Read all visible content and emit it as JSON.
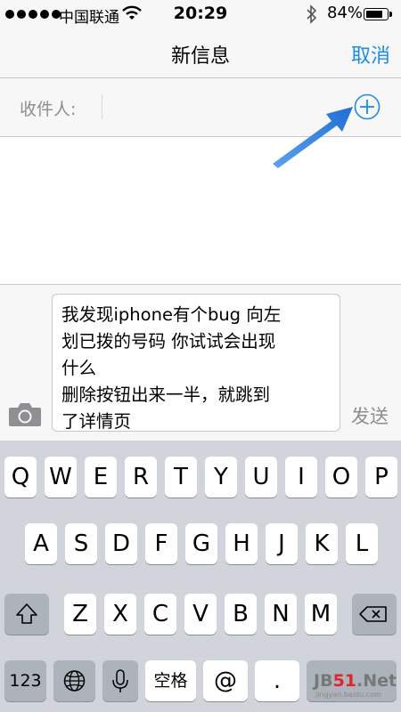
{
  "status_bar": {
    "carrier": "中国联通",
    "time": "20:29",
    "battery": "84%",
    "battery_level": 0.84
  },
  "nav": {
    "title": "新信息",
    "cancel": "取消"
  },
  "recipient": {
    "label": "收件人:"
  },
  "compose": {
    "lines": [
      "我发现iphone有个bug 向左",
      "划已拨的号码 你试试会出现",
      "什么",
      "删除按钮出来一半，就跳到",
      "了详情页"
    ],
    "send": "发送"
  },
  "keyboard": {
    "row1": [
      "Q",
      "W",
      "E",
      "R",
      "T",
      "Y",
      "U",
      "I",
      "O",
      "P"
    ],
    "row2": [
      "A",
      "S",
      "D",
      "F",
      "G",
      "H",
      "J",
      "K",
      "L"
    ],
    "row3": [
      "Z",
      "X",
      "C",
      "V",
      "B",
      "N",
      "M"
    ],
    "numbers": "123",
    "space": "空格",
    "at": "@",
    "period": "."
  },
  "watermark": {
    "logo_a": "JB",
    "logo_b": "51",
    "logo_c": ".Net",
    "sub": "jingyan.baidu.com"
  },
  "colors": {
    "accent": "#1a8cf0",
    "arrow": "#2f7de1"
  }
}
